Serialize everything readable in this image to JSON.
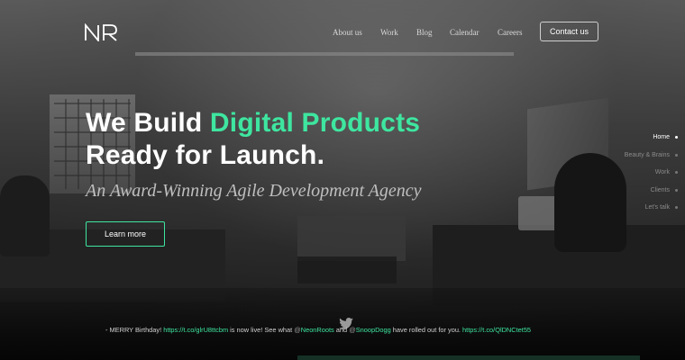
{
  "logo": {
    "text": "NR"
  },
  "nav": {
    "items": [
      {
        "label": "About us"
      },
      {
        "label": "Work"
      },
      {
        "label": "Blog"
      },
      {
        "label": "Calendar"
      },
      {
        "label": "Careers"
      }
    ],
    "contact_label": "Contact us"
  },
  "hero": {
    "headline_line1_prefix": "We Build ",
    "headline_line1_accent": "Digital Products",
    "headline_line2": "Ready for Launch.",
    "tagline": "An Award-Winning Agile Development Agency",
    "cta_label": "Learn more"
  },
  "side_nav": {
    "items": [
      {
        "label": "Home",
        "active": true
      },
      {
        "label": "Beauty & Brains",
        "active": false
      },
      {
        "label": "Work",
        "active": false
      },
      {
        "label": "Clients",
        "active": false
      },
      {
        "label": "Let's talk",
        "active": false
      }
    ]
  },
  "tweet": {
    "prefix": "- MERRY Birthday! ",
    "link1": "https://t.co/glrU8ttcbm",
    "text1": " is now live! See what ",
    "mention1_at": "@",
    "mention1": "NeonRoots",
    "text2": " and ",
    "mention2_at": "@",
    "mention2": "SnoopDogg",
    "text3": " have rolled out for you. ",
    "link2": "https://t.co/QlDNCtet55"
  },
  "colors": {
    "accent": "#3ee6a0",
    "background": "#1a1a1a"
  },
  "icons": [
    "logo-mark",
    "twitter-icon"
  ]
}
